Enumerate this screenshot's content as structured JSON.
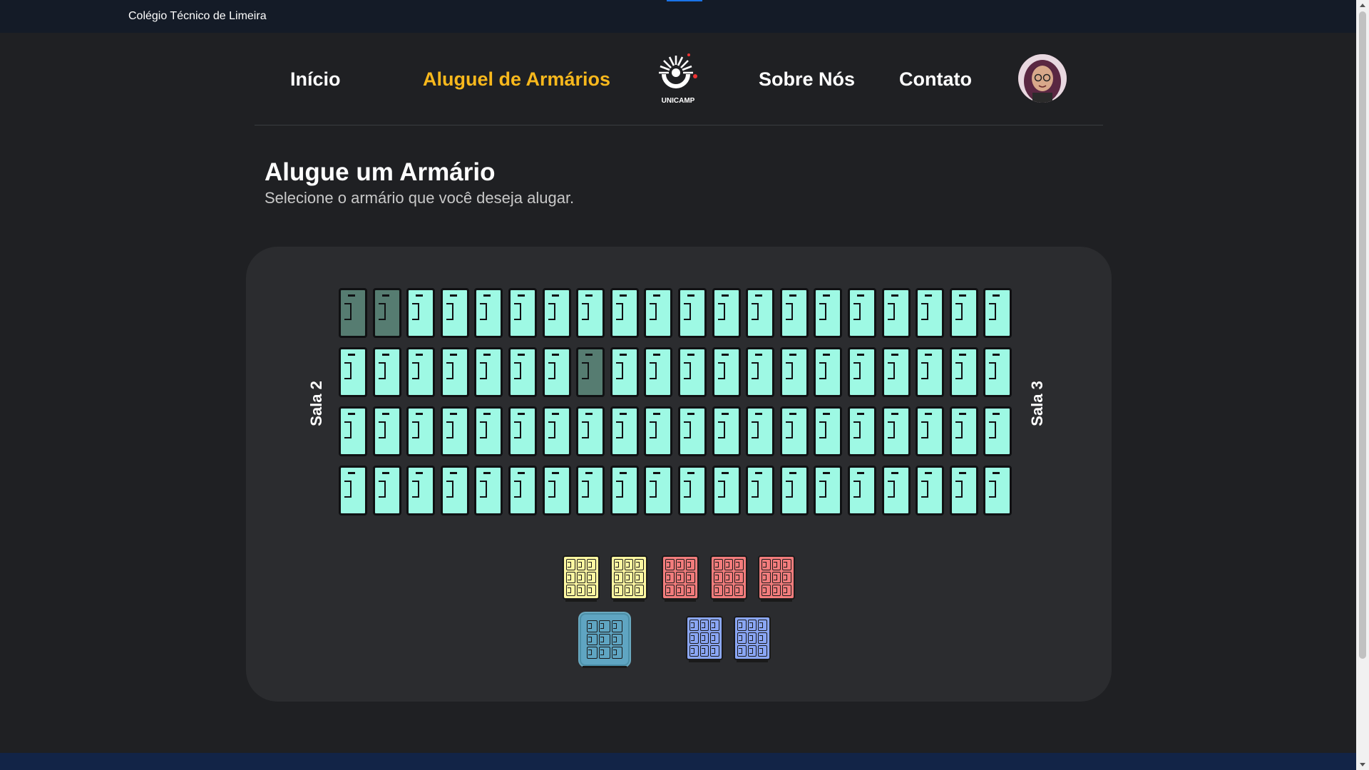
{
  "topbar": {
    "site_name": "Colégio Técnico de Limeira"
  },
  "nav": {
    "items": [
      {
        "label": "Início"
      },
      {
        "label": "Aluguel de Armários",
        "active": true
      },
      {
        "label": "Sobre Nós"
      },
      {
        "label": "Contato"
      }
    ],
    "logo_text": "UNICAMP"
  },
  "main": {
    "title": "Alugue um Armário",
    "subtitle": "Selecione o armário que você deseja alugar."
  },
  "locker_map": {
    "left_label": "Sala 2",
    "right_label": "Sala 3",
    "rows": 4,
    "columns": 20,
    "occupied": [
      [
        0,
        0
      ],
      [
        0,
        1
      ],
      [
        1,
        7
      ]
    ],
    "colors": {
      "available": "#9ef9e4",
      "occupied": "#567c71",
      "yellow_group": "#fdf7a1",
      "red_group": "#f27c7c",
      "blue_group": "#8aa6f5",
      "selected_group": "#5fa5c2"
    },
    "cabinet_groups": [
      {
        "color": "yellow",
        "count": 2
      },
      {
        "color": "red",
        "count": 3
      },
      {
        "color": "teal",
        "count": 1,
        "selected": true
      },
      {
        "color": "blue",
        "count": 2
      }
    ]
  }
}
